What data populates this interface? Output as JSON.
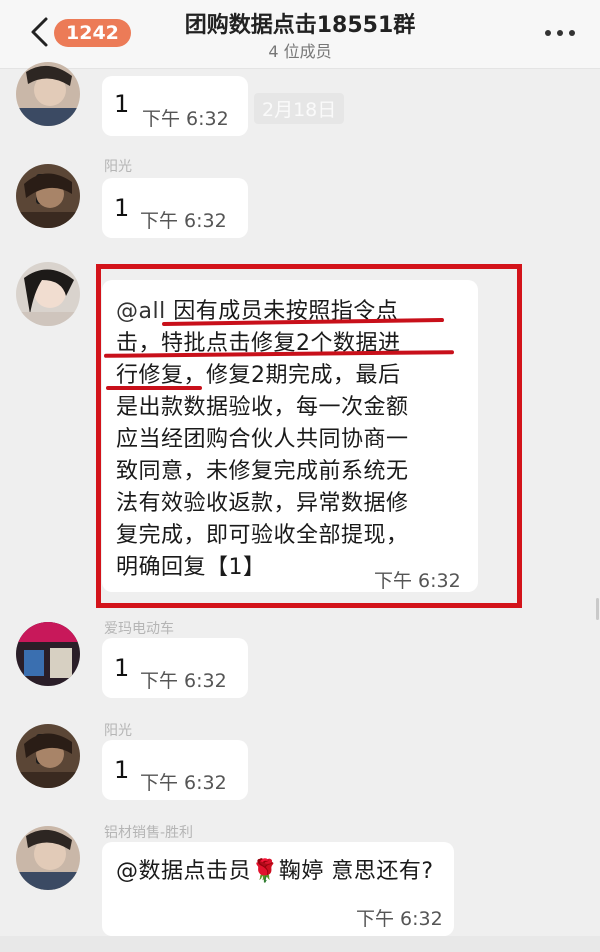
{
  "header": {
    "back_icon": "chevron-left-icon",
    "unread_count": "1242",
    "title": "团购数据点击18551群",
    "subtitle": "4 位成员",
    "more_icon": "more-dots-icon"
  },
  "date_divider": "2月18日",
  "messages": [
    {
      "sender": "",
      "text": "1",
      "time": "下午 6:32"
    },
    {
      "sender": "阳光",
      "text": "1",
      "time": "下午 6:32"
    },
    {
      "sender": "",
      "mention": "@all",
      "text_parts": [
        "因有成员未按照指令点",
        "击，特批点击修复2个数据进",
        "行修复，修复2期完成，最后",
        "是出款数据验收，每一次金额",
        "应当经团购合伙人共同协商一",
        "致同意，未修复完成前系统无",
        "法有效验收返款，异常数据修",
        "复完成，即可验收全部提现，",
        "明确回复【1】"
      ],
      "time": "下午 6:32"
    },
    {
      "sender": "爱玛电动车",
      "text": "1",
      "time": "下午 6:32"
    },
    {
      "sender": "阳光",
      "text": "1",
      "time": "下午 6:32"
    },
    {
      "sender": "铝材销售-胜利",
      "text": "@数据点击员🌹鞠婷 意思还有?",
      "time": "下午 6:32"
    }
  ],
  "colors": {
    "highlight_box": "#d3131a",
    "badge": "#ec7b57",
    "background": "#efefef"
  }
}
